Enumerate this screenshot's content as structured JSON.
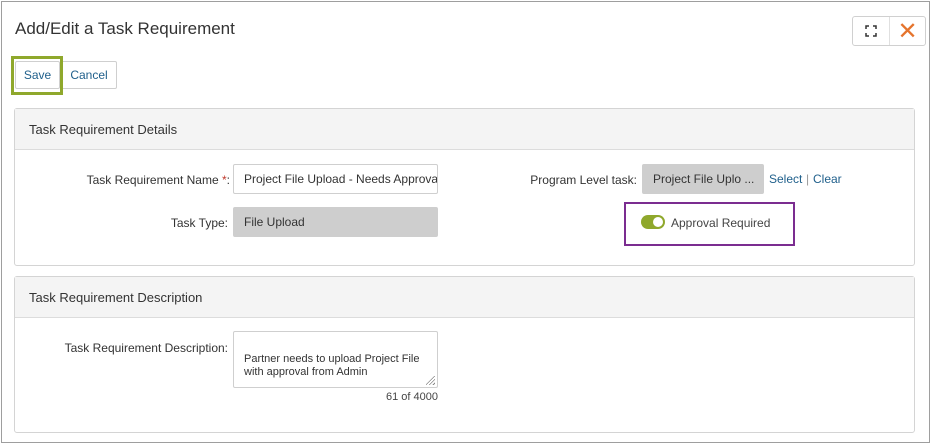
{
  "dialog": {
    "title": "Add/Edit a Task Requirement",
    "close_symbol": "✕",
    "icons": {
      "maximize": "expand-icon",
      "close": "close-icon"
    }
  },
  "toolbar": {
    "save_label": "Save",
    "cancel_label": "Cancel"
  },
  "details": {
    "header": "Task Requirement Details",
    "name_label": "Task Requirement Name",
    "name_required_mark": "*",
    "name_label_suffix": ":",
    "name_value": "Project File Upload - Needs Approval",
    "task_type_label": "Task Type:",
    "task_type_value": "File Upload",
    "program_task_label": "Program Level task:",
    "program_task_value": "Project File Uplo ...",
    "select_link": "Select",
    "link_separator": "|",
    "clear_link": "Clear",
    "approval_label": "Approval Required",
    "approval_on": true
  },
  "description": {
    "header": "Task Requirement Description",
    "label": "Task Requirement Description:",
    "value": "Partner needs to upload Project File with approval from Admin",
    "counter": "61 of 4000"
  },
  "colors": {
    "accent_green": "#8fa82c",
    "highlight_purple": "#7b2d90",
    "link_blue": "#1f5f8b",
    "close_orange": "#e5742d"
  }
}
